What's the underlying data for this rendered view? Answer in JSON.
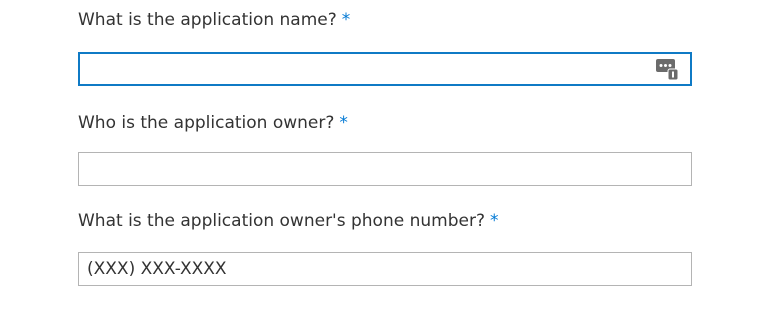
{
  "form": {
    "questions": [
      {
        "label": "What is the application name?",
        "required_mark": "*",
        "value": "",
        "placeholder": ""
      },
      {
        "label": "Who is the application owner?",
        "required_mark": "*",
        "value": "",
        "placeholder": ""
      },
      {
        "label": "What is the application owner's phone number?",
        "required_mark": "*",
        "value": "",
        "placeholder": "(XXX) XXX-XXXX"
      }
    ],
    "autofill_icon": "password-manager-icon"
  },
  "colors": {
    "accent": "#0f7ac5",
    "required": "#0078d4",
    "text": "#333333",
    "border": "#b4b4b4"
  }
}
